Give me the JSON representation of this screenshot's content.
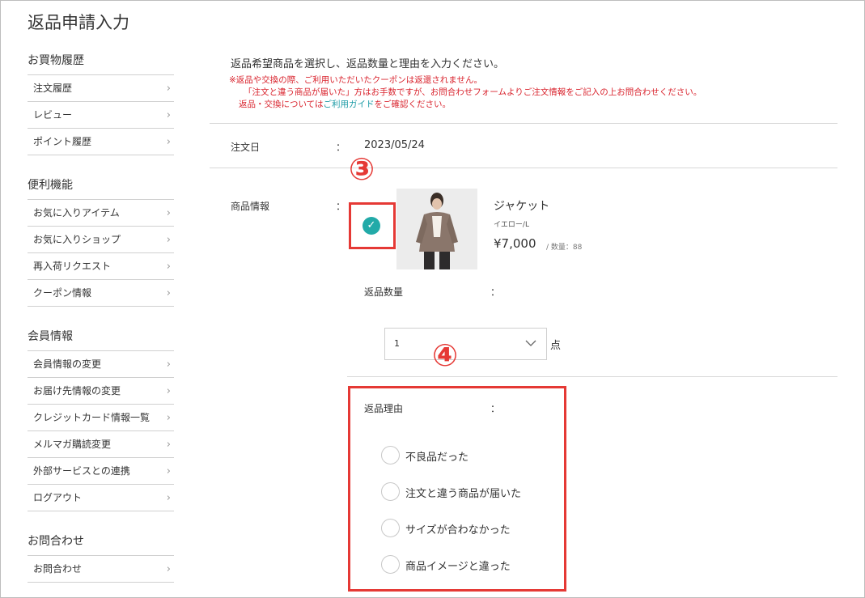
{
  "page": {
    "title": "返品申請入力"
  },
  "sidebar": {
    "sections": [
      {
        "heading": "お買物履歴",
        "items": [
          {
            "label": "注文履歴"
          },
          {
            "label": "レビュー"
          },
          {
            "label": "ポイント履歴"
          }
        ]
      },
      {
        "heading": "便利機能",
        "items": [
          {
            "label": "お気に入りアイテム"
          },
          {
            "label": "お気に入りショップ"
          },
          {
            "label": "再入荷リクエスト"
          },
          {
            "label": "クーポン情報"
          }
        ]
      },
      {
        "heading": "会員情報",
        "items": [
          {
            "label": "会員情報の変更"
          },
          {
            "label": "お届け先情報の変更"
          },
          {
            "label": "クレジットカード情報一覧"
          },
          {
            "label": "メルマガ購読変更"
          },
          {
            "label": "外部サービスとの連携"
          },
          {
            "label": "ログアウト"
          }
        ]
      },
      {
        "heading": "お問合わせ",
        "items": [
          {
            "label": "お問合わせ"
          }
        ]
      }
    ],
    "chevron": "›"
  },
  "main": {
    "intro": "返品希望商品を選択し、返品数量と理由を入力ください。",
    "notes": {
      "line1": "※返品や交換の際、ご利用いただいたクーポンは返還されません。",
      "line2": "「注文と違う商品が届いた」方はお手数ですが、お問合わせフォームよりご注文情報をご記入の上お問合わせください。",
      "line3_pre": "返品・交換については",
      "line3_link": "ご利用ガイド",
      "line3_post": "をご確認ください。"
    },
    "colon": "：",
    "order_date": {
      "label": "注文日",
      "value": "2023/05/24"
    },
    "product": {
      "label": "商品情報",
      "name": "ジャケット",
      "color": "イエロー/L",
      "price": "¥7,000",
      "stock": "/ 数量：88",
      "checked": true
    },
    "quantity": {
      "label": "返品数量",
      "selected": "1",
      "unit": "点"
    },
    "reason": {
      "label": "返品理由",
      "options": [
        {
          "label": "不良品だった"
        },
        {
          "label": "注文と違う商品が届いた"
        },
        {
          "label": "サイズが合わなかった"
        },
        {
          "label": "商品イメージと違った"
        }
      ]
    }
  },
  "annotations": {
    "step3": "③",
    "step4": "④"
  },
  "colors": {
    "accent": "#22aaa8",
    "highlight": "#e53935",
    "warning": "#d9232d"
  }
}
